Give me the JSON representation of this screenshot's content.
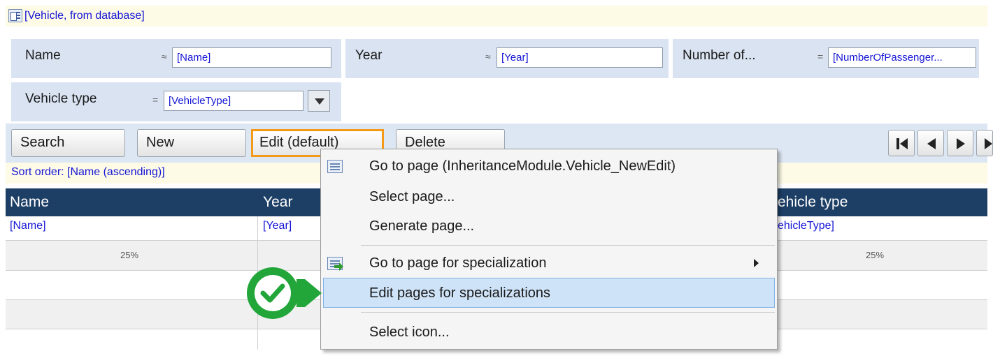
{
  "header": {
    "title": "[Vehicle, from database]"
  },
  "filters": [
    {
      "label": "Name",
      "operator": "≈",
      "value": "[Name]"
    },
    {
      "label": "Year",
      "operator": "≈",
      "value": "[Year]"
    },
    {
      "label": "Number of...",
      "operator": "=",
      "value": "[NumberOfPassenger..."
    },
    {
      "label": "Vehicle type",
      "operator": "=",
      "value": "[VehicleType]"
    }
  ],
  "toolbar": {
    "search_label": "Search",
    "new_label": "New",
    "edit_label": "Edit (default)",
    "delete_label": "Delete",
    "nav_icons": [
      "first-icon",
      "previous-icon",
      "next-icon",
      "last-icon"
    ]
  },
  "sort_order": "Sort order: [Name (ascending)]",
  "grid": {
    "columns": [
      "Name",
      "Year",
      "ehicle type"
    ],
    "row": [
      "[Name]",
      "[Year]",
      "ehicleType]"
    ],
    "widths": [
      "25%",
      "25%"
    ]
  },
  "context_menu": {
    "items": [
      {
        "label": "Go to page (InheritanceModule.Vehicle_NewEdit)",
        "icon": "page-icon"
      },
      {
        "label": "Select page..."
      },
      {
        "label": "Generate page..."
      },
      {
        "label": "Go to page for specialization",
        "icon": "page-arrow-icon",
        "submenu": true
      },
      {
        "label": "Edit pages for specializations",
        "highlighted": true
      },
      {
        "label": "Select icon..."
      }
    ]
  },
  "colors": {
    "link_blue": "#1515d6",
    "grid_header": "#1d3f66",
    "selected_outline": "#f39a19",
    "callout_green": "#22a63a"
  }
}
